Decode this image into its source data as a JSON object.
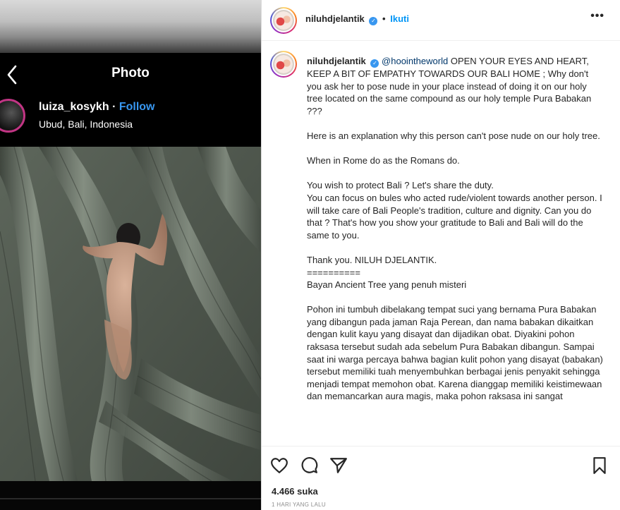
{
  "left_panel": {
    "screen_title": "Photo",
    "username": "luiza_kosykh",
    "separator": "·",
    "follow_label": "Follow",
    "location": "Ubud, Bali, Indonesia"
  },
  "post": {
    "header": {
      "username": "niluhdjelantik",
      "verified_mark": "✓",
      "separator": "•",
      "follow_label": "Ikuti",
      "more_label": "•••"
    },
    "caption": {
      "username": "niluhdjelantik",
      "mention": "@hoointheworld",
      "paragraphs": [
        "OPEN YOUR EYES AND HEART, KEEP A BIT OF EMPATHY TOWARDS OUR BALI HOME ; Why don't you ask her to pose nude in your place instead of doing it on our holy tree located on the same compound as our holy temple Pura Babakan ???",
        "Here is an explanation why this person can't pose nude on our holy tree.",
        "When in Rome do as the Romans do.",
        "You wish to protect Bali ? Let's share the duty.\nYou can focus on bules who acted rude/violent towards another person. I will take care of Bali People's tradition, culture and dignity. Can you do that ? That's how you show your gratitude to Bali and Bali will do the same to you.",
        "Thank you. NILUH DJELANTIK.\n==========\nBayan Ancient Tree yang penuh misteri",
        "Pohon ini tumbuh dibelakang tempat suci yang bernama Pura Babakan yang dibangun pada jaman Raja Perean, dan nama babakan dikaitkan dengan kulit kayu yang disayat dan dijadikan obat. Diyakini pohon raksasa tersebut sudah ada sebelum Pura Babakan dibangun. Sampai saat ini warga percaya bahwa bagian kulit pohon yang disayat (babakan) tersebut memiliki tuah menyembuhkan berbagai jenis penyakit sehingga menjadi tempat memohon obat. Karena dianggap memiliki keistimewaan dan memancarkan aura magis, maka pohon raksasa ini sangat"
      ]
    },
    "actions": {
      "like_icon": "heart-icon",
      "comment_icon": "comment-icon",
      "share_icon": "share-icon",
      "save_icon": "bookmark-icon"
    },
    "likes": "4.466 suka",
    "timestamp": "1 HARI YANG LALU"
  },
  "colors": {
    "link_blue": "#0095f6",
    "follow_blue": "#3897f0",
    "mention": "#00376b",
    "muted": "#8e8e8e"
  }
}
